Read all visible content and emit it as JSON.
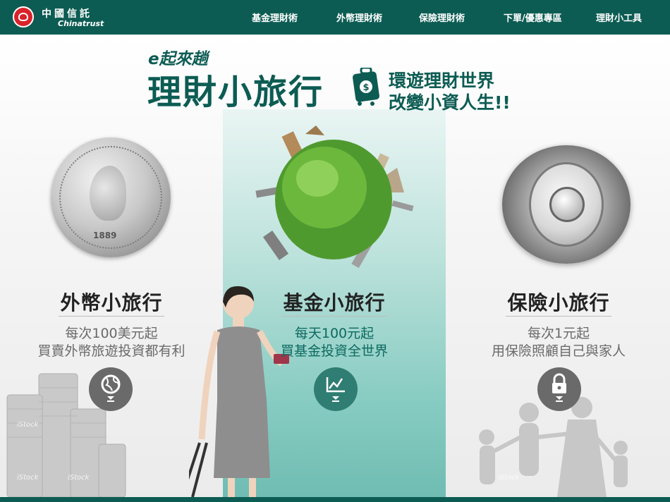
{
  "header": {
    "brand_cn": "中國信託",
    "brand_en": "Chinatrust",
    "nav": [
      "基金理財術",
      "外幣理財術",
      "保險理財術",
      "下單/優惠專區",
      "理財小工具"
    ]
  },
  "hero": {
    "subtitle": "e起來趟",
    "title": "理財小旅行",
    "slogan_line1": "環遊理財世界",
    "slogan_line2": "改變小資人生!!"
  },
  "columns": [
    {
      "title": "外幣小旅行",
      "line1": "每次100美元起",
      "line2": "買賣外幣旅遊投資都有利",
      "icon": "globe-icon"
    },
    {
      "title": "基金小旅行",
      "line1": "每天100元起",
      "line2": "買基金投資全世界",
      "icon": "chart-icon"
    },
    {
      "title": "保險小旅行",
      "line1": "每次1元起",
      "line2": "用保險照顧自己與家人",
      "icon": "lock-icon"
    }
  ],
  "coin": {
    "year": "1889"
  },
  "watermark": "iStock",
  "colors": {
    "brand": "#0c5c53",
    "accent_mid": "#6fbcb2",
    "logo_red": "#d9222a"
  }
}
